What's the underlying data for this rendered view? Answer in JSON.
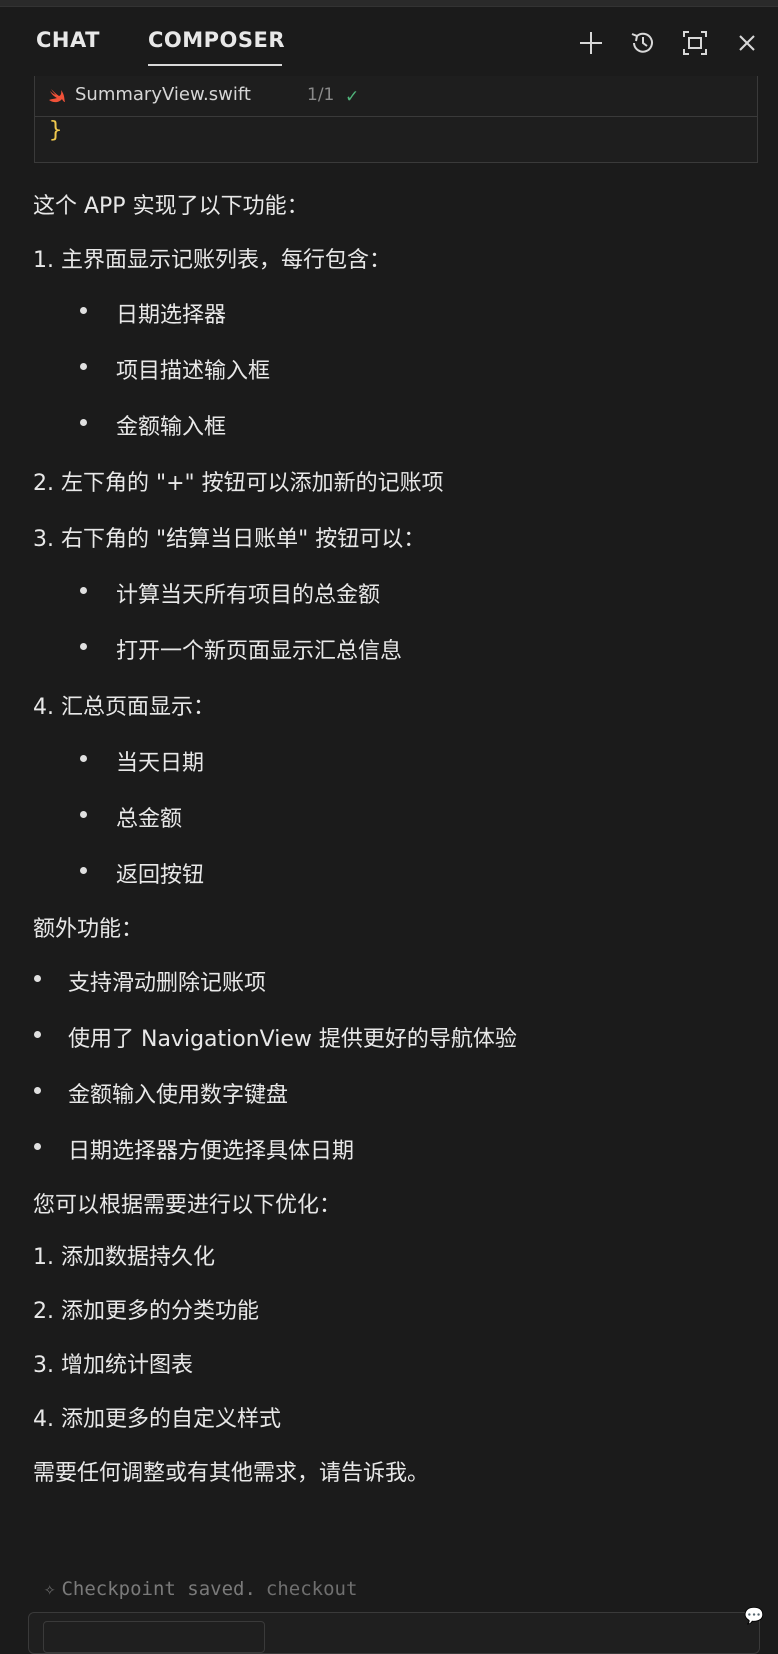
{
  "header": {
    "tabs": [
      {
        "label": "CHAT",
        "active": false
      },
      {
        "label": "COMPOSER",
        "active": true
      }
    ],
    "icons": [
      "plus-icon",
      "history-icon",
      "maximize-icon",
      "close-icon"
    ]
  },
  "code_card": {
    "file_name": "SummaryView.swift",
    "count": "1/1",
    "code_line": "}"
  },
  "message": {
    "intro": "这个 APP 实现了以下功能：",
    "item1": "1. 主界面显示记账列表，每行包含：",
    "item1_subs": [
      "日期选择器",
      "项目描述输入框",
      "金额输入框"
    ],
    "item2": "2. 左下角的 \"+\" 按钮可以添加新的记账项",
    "item3": "3. 右下角的 \"结算当日账单\" 按钮可以：",
    "item3_subs": [
      "计算当天所有项目的总金额",
      "打开一个新页面显示汇总信息"
    ],
    "item4": "4. 汇总页面显示：",
    "item4_subs": [
      "当天日期",
      "总金额",
      "返回按钮"
    ],
    "extra_title": "额外功能：",
    "extra_items": [
      "支持滑动删除记账项",
      "使用了 NavigationView 提供更好的导航体验",
      "金额输入使用数字键盘",
      "日期选择器方便选择具体日期"
    ],
    "optimize_title": "您可以根据需要进行以下优化：",
    "optimize_items": [
      "1. 添加数据持久化",
      "2. 添加更多的分类功能",
      "3. 增加统计图表",
      "4. 添加更多的自定义样式"
    ],
    "closing": "需要任何调整或有其他需求，请告诉我。"
  },
  "checkpoint": {
    "text": "Checkpoint saved.",
    "link": "checkout"
  }
}
